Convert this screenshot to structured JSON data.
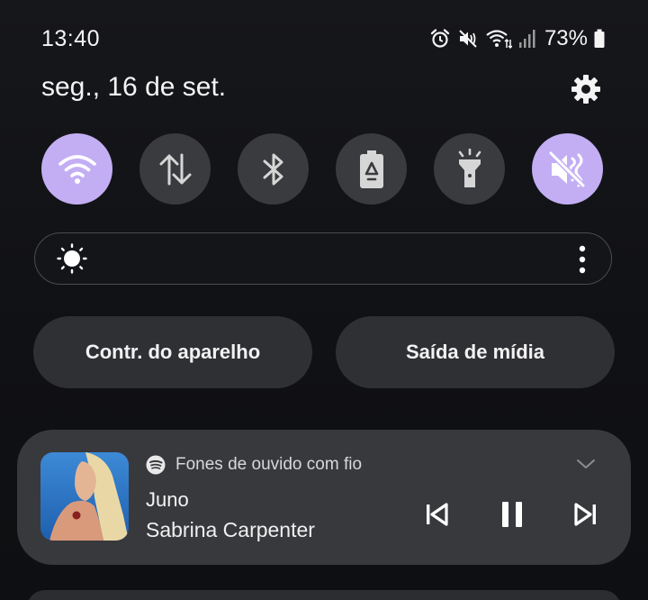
{
  "status_bar": {
    "time": "13:40",
    "battery": "73%",
    "icons": [
      "alarm-icon",
      "mute-icon",
      "wifi-icon",
      "signal-icon",
      "battery-icon"
    ]
  },
  "date": "seg., 16 de set.",
  "quick_toggles": [
    {
      "name": "wifi",
      "icon": "wifi-icon",
      "active": true
    },
    {
      "name": "mobile-data",
      "icon": "data-arrows-icon",
      "active": false
    },
    {
      "name": "bluetooth",
      "icon": "bluetooth-icon",
      "active": false
    },
    {
      "name": "power-saving",
      "icon": "battery-saver-icon",
      "active": false
    },
    {
      "name": "flashlight",
      "icon": "flashlight-icon",
      "active": false
    },
    {
      "name": "sound-mute",
      "icon": "mute-icon",
      "active": true
    }
  ],
  "buttons": {
    "device_control": "Contr. do aparelho",
    "media_output": "Saída de mídia"
  },
  "media": {
    "source_app_icon": "spotify-icon",
    "output_device": "Fones de ouvido com fio",
    "title": "Juno",
    "artist": "Sabrina Carpenter"
  },
  "colors": {
    "accent": "#c3aef4",
    "toggle_off": "#3a3b3f",
    "card": "#38393d",
    "background": "#101114"
  }
}
